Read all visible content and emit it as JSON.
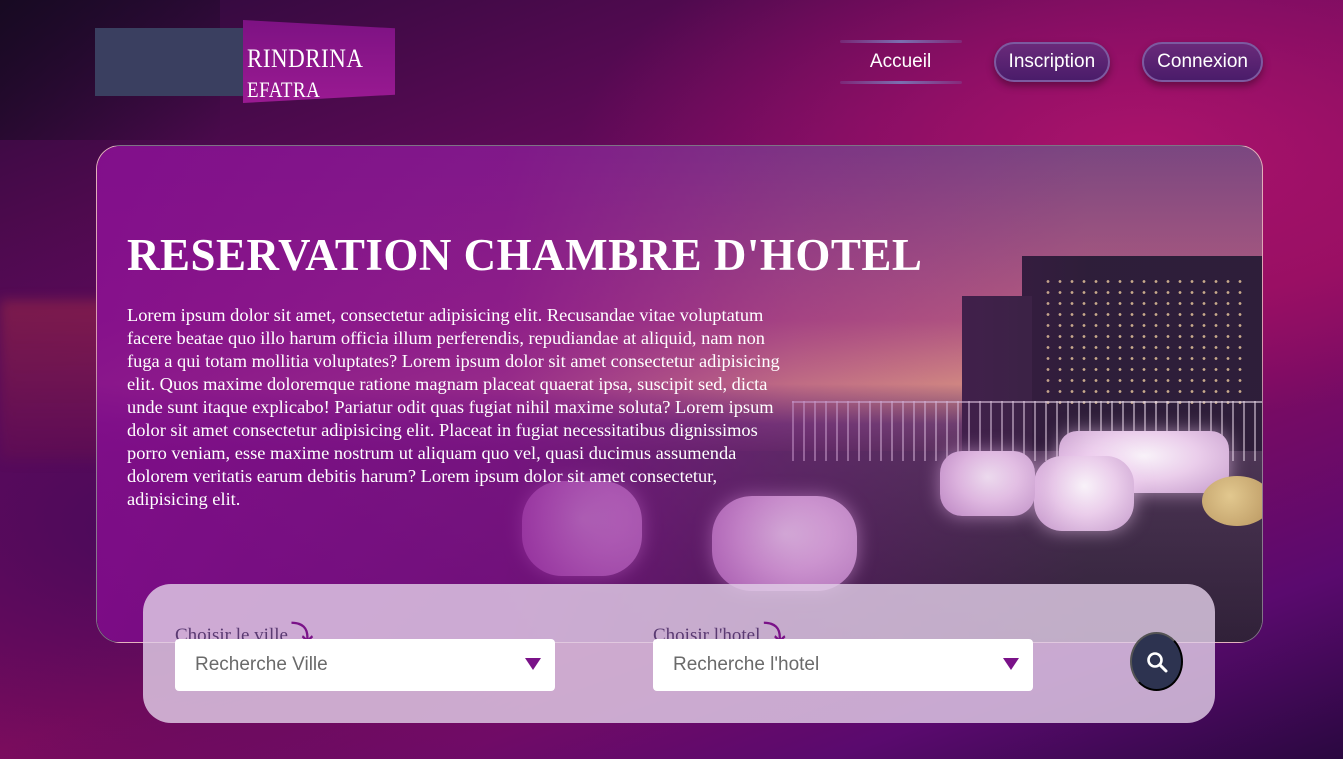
{
  "brand": {
    "name_main": "RINDRINA",
    "name_sub": "EFATRA"
  },
  "nav": {
    "home": "Accueil",
    "register": "Inscription",
    "login": "Connexion"
  },
  "hero": {
    "title": "RESERVATION CHAMBRE D'HOTEL",
    "text": "Lorem ipsum dolor sit amet, consectetur adipisicing elit. Recusandae vitae voluptatum facere beatae quo illo harum officia illum perferendis, repudiandae at aliquid, nam non fuga a qui totam mollitia voluptates? Lorem ipsum dolor sit amet consectetur adipisicing elit. Quos maxime doloremque ratione magnam placeat quaerat ipsa, suscipit sed, dicta unde sunt itaque explicabo! Pariatur odit quas fugiat nihil maxime soluta? Lorem ipsum dolor sit amet consectetur adipisicing elit. Placeat in fugiat necessitatibus dignissimos porro veniam, esse maxime nostrum ut aliquam quo vel, quasi ducimus assumenda dolorem veritatis earum debitis harum? Lorem ipsum dolor sit amet consectetur, adipisicing elit."
  },
  "search": {
    "city_label": "Choisir le ville",
    "city_placeholder": "Recherche Ville",
    "hotel_label": "Choisir l'hotel",
    "hotel_placeholder": "Recherche l'hotel",
    "arrow_glyph": "⤵",
    "button_icon": "search-icon"
  },
  "colors": {
    "accent": "#7a1288",
    "button_dark": "#2d3350",
    "hero_tint": "#820a8c"
  }
}
